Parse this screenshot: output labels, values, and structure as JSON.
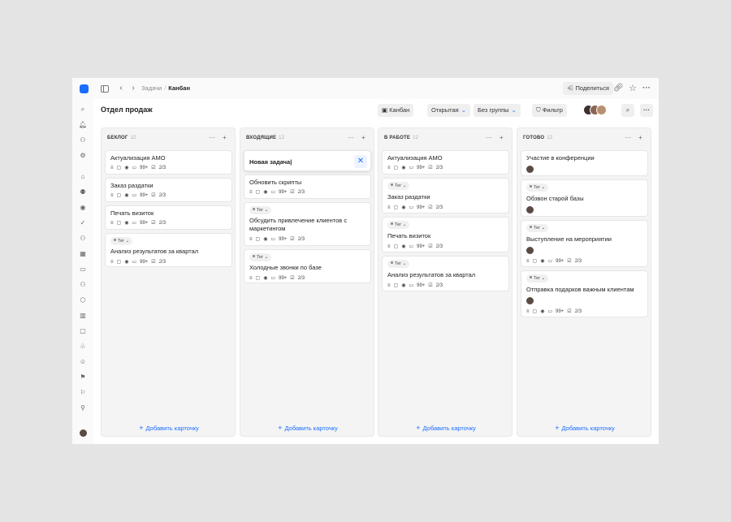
{
  "topbar": {
    "breadcrumb": [
      "Задачи",
      "Канбан"
    ],
    "share_label": "Поделиться",
    "share_icon": "share-icon",
    "icons": [
      "sidebar-toggle-icon",
      "back-icon",
      "forward-icon",
      "link-icon",
      "star-icon",
      "more-icon"
    ]
  },
  "header": {
    "title": "Отдел продаж",
    "view_label": "Канбан",
    "status_label": "Открытая",
    "group_label": "Без группы",
    "filter_label": "Фильтр"
  },
  "sidebar": {
    "icons": [
      "search-icon",
      "bell-icon",
      "users-icon",
      "gear-icon",
      "home-icon",
      "team-icon",
      "user-circle-icon",
      "check-circle-icon",
      "group-icon",
      "calendar-icon",
      "folder-icon",
      "people-icon",
      "settings-icon",
      "chart-icon",
      "chat-icon",
      "org-icon",
      "smile-icon",
      "flag-icon",
      "flag-plus-icon",
      "add-user-icon"
    ]
  },
  "columns": [
    {
      "title": "БЕКЛОГ",
      "count": "12",
      "add_label": "Добавить карточку",
      "cards": [
        {
          "title": "Актуализация АМО",
          "views": "99+",
          "progress": "2/3"
        },
        {
          "title": "Заказ раздатки",
          "views": "99+",
          "progress": "2/3"
        },
        {
          "title": "Печать визиток",
          "views": "99+",
          "progress": "2/3"
        },
        {
          "tag": "Тег",
          "title": "Анализ результатов за квартал",
          "views": "99+",
          "progress": "2/3"
        }
      ]
    },
    {
      "title": "ВХОДЯЩИЕ",
      "count": "12",
      "add_label": "Добавить карточку",
      "new_card_value": "Новая задача|",
      "cards": [
        {
          "title": "Обновить скрипты",
          "views": "99+",
          "progress": "2/3"
        },
        {
          "tag": "Тег",
          "title": "Обсудить привлечение клиентов с маркетингом",
          "views": "99+",
          "progress": "2/3"
        },
        {
          "tag": "Тег",
          "title": "Холодные звонки по базе",
          "views": "99+",
          "progress": "2/3"
        }
      ]
    },
    {
      "title": "В РАБОТЕ",
      "count": "12",
      "add_label": "Добавить карточку",
      "cards": [
        {
          "title": "Актуализация АМО",
          "views": "99+",
          "progress": "2/3"
        },
        {
          "tag": "Тег",
          "title": "Заказ раздатки",
          "views": "99+",
          "progress": "2/3"
        },
        {
          "tag": "Тег",
          "title": "Печать визиток",
          "views": "99+",
          "progress": "2/3"
        },
        {
          "tag": "Тег",
          "title": "Анализ результатов за квартал",
          "views": "99+",
          "progress": "2/3"
        }
      ]
    },
    {
      "title": "ГОТОВО",
      "count": "12",
      "add_label": "Добавить карточку",
      "cards": [
        {
          "title": "Участие в конференции"
        },
        {
          "tag": "Тег",
          "title": "Обзвон старой базы"
        },
        {
          "tag": "Тег",
          "title": "Выступление на мероприятии",
          "views": "99+",
          "progress": "2/3"
        },
        {
          "tag": "Тег",
          "title": "Отправка подарков важным клиентам",
          "views": "99+",
          "progress": "2/3"
        }
      ]
    }
  ],
  "colors": {
    "accent": "#1a6dff",
    "background": "#e4e4e4",
    "column": "#f4f4f5"
  }
}
